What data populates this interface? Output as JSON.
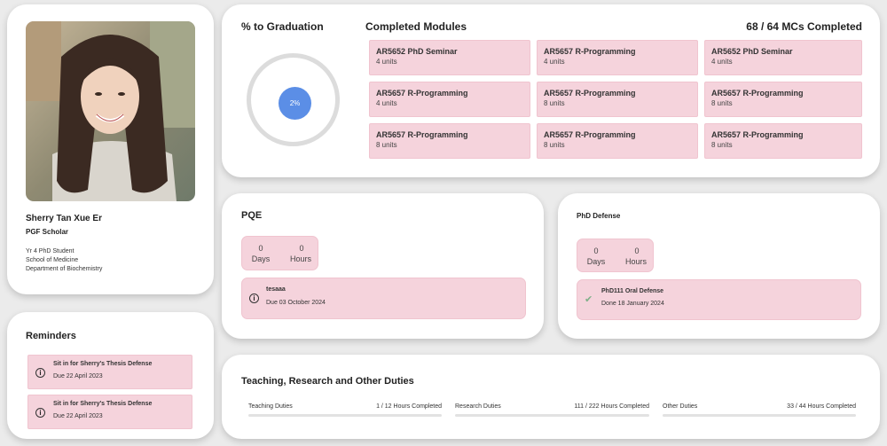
{
  "profile": {
    "name": "Sherry Tan Xue Er",
    "role": "PGF Scholar",
    "year": "Yr 4 PhD Student",
    "school": "School of Medicine",
    "department": "Department of Biochemistry"
  },
  "reminders": {
    "title": "Reminders",
    "items": [
      {
        "title": "Sit in for Sherry's Thesis Defense",
        "due": "Due 22 April 2023"
      },
      {
        "title": "Sit in for Sherry's Thesis Defense",
        "due": "Due 22 April 2023"
      }
    ]
  },
  "graduation": {
    "title": "% to Graduation",
    "percent_label": "2%",
    "percent_value": 2,
    "ring_color": "#dcdcdc",
    "progress_color": "#5b8ee6"
  },
  "modules": {
    "title": "Completed Modules",
    "mcs_completed": "68 / 64 MCs Completed",
    "items": [
      {
        "name": "AR5652 PhD Seminar",
        "units": "4 units"
      },
      {
        "name": "AR5657 R-Programming",
        "units": "4 units"
      },
      {
        "name": "AR5652 PhD Seminar",
        "units": "4 units"
      },
      {
        "name": "AR5657 R-Programming",
        "units": "4 units"
      },
      {
        "name": "AR5657 R-Programming",
        "units": "8 units"
      },
      {
        "name": "AR5657 R-Programming",
        "units": "8 units"
      },
      {
        "name": "AR5657 R-Programming",
        "units": "8 units"
      },
      {
        "name": "AR5657 R-Programming",
        "units": "8 units"
      },
      {
        "name": "AR5657 R-Programming",
        "units": "8 units"
      }
    ]
  },
  "pqe": {
    "title": "PQE",
    "days_value": "0",
    "days_label": "Days",
    "hours_value": "0",
    "hours_label": "Hours",
    "item_title": "tesaaa",
    "item_due": "Due 03 October 2024",
    "icon": "alert-circle-icon"
  },
  "phd_defense": {
    "title": "PhD Defense",
    "days_value": "0",
    "days_label": "Days",
    "hours_value": "0",
    "hours_label": "Hours",
    "item_title": "PhD111 Oral Defense",
    "item_due": "Done 18 January 2024",
    "icon": "check-icon"
  },
  "duties": {
    "title": "Teaching, Research and Other Duties",
    "items": [
      {
        "label": "Teaching Duties",
        "value": "1 / 12 Hours Completed"
      },
      {
        "label": "Research Duties",
        "value": "111 / 222 Hours Completed"
      },
      {
        "label": "Other Duties",
        "value": "33 / 44 Hours Completed"
      }
    ]
  },
  "colors": {
    "accent_pink": "#f5d3dc",
    "accent_blue": "#5b8ee6",
    "background": "#ebebeb"
  }
}
